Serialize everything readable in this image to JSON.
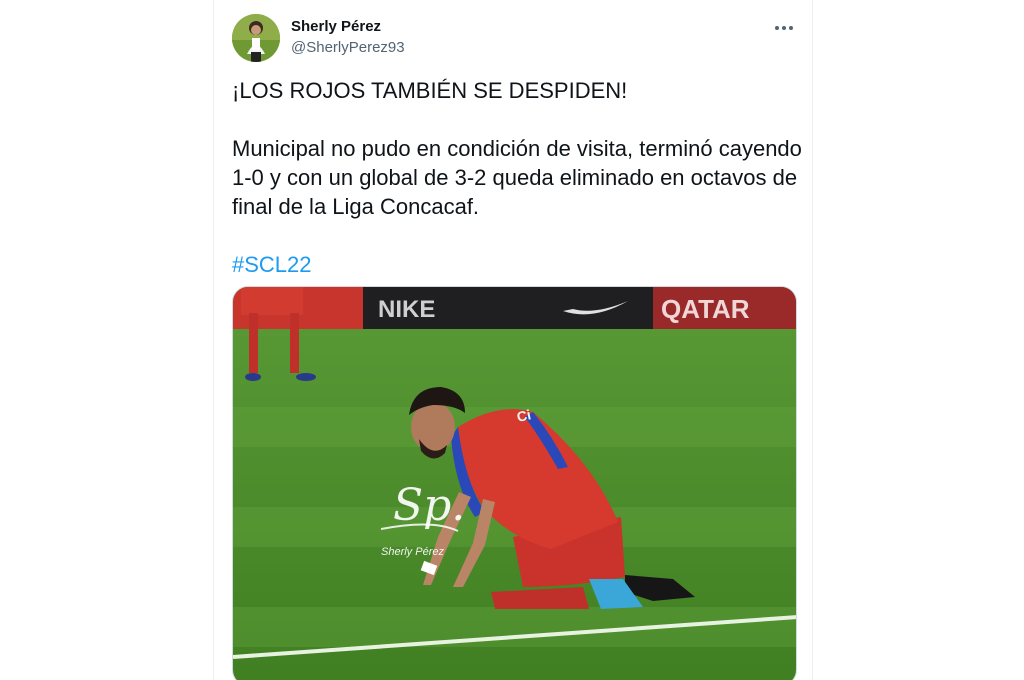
{
  "tweet": {
    "author": {
      "name": "Sherly Pérez",
      "handle": "@SherlyPerez93"
    },
    "headline": "¡LOS ROJOS TAMBIÉN SE DESPIDEN!",
    "body": "Municipal no pudo en condición de visita, terminó cayendo 1-0 y con un global de 3-2 queda eliminado en octavos de final de la Liga Concacaf.",
    "hashtag": "#SCL22",
    "media": {
      "banner_text_left": "NIKE",
      "banner_text_right": "QATAR",
      "player_number_text": "Ci",
      "watermark_monogram": "Sp.",
      "watermark_name": "Sherly Pérez"
    }
  },
  "colors": {
    "link": "#1d9bf0",
    "text": "#0f1419",
    "secondary_text": "#536471",
    "pitch": "#4a8a2a",
    "jersey_red": "#d63a2e",
    "jersey_blue": "#2a48b8"
  },
  "icons": {
    "more": "more-dots-icon"
  }
}
